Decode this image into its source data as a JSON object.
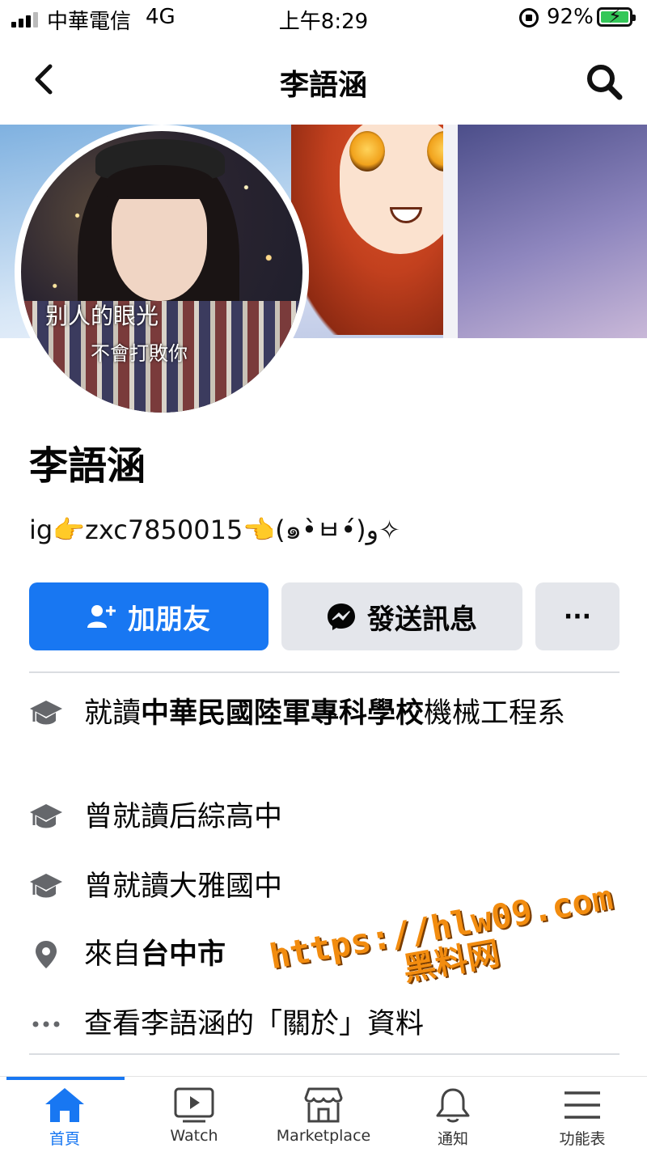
{
  "status_bar": {
    "carrier": "中華電信",
    "network": "4G",
    "time": "上午8:29",
    "battery_percent": "92%",
    "battery_charging": true
  },
  "header": {
    "title": "李語涵",
    "back_icon": "chevron-left-icon",
    "search_icon": "search-icon"
  },
  "profile": {
    "avatar_text_line1": "别人的眼光",
    "avatar_text_line2": "不會打敗你",
    "name": "李語涵",
    "bio": "ig👉zxc7850015👈(๑•̀ㅂ•́)و✧"
  },
  "actions": {
    "add_friend_label": "加朋友",
    "message_label": "發送訊息",
    "more_label": "···"
  },
  "info": {
    "education_1": {
      "prefix": "就讀",
      "school": "中華民國陸軍專科學校",
      "suffix": "機械工程系"
    },
    "education_2": "曾就讀后綜高中",
    "education_3": "曾就讀大雅國中",
    "hometown": {
      "prefix": "來自",
      "city": "台中市"
    },
    "see_about": "查看李語涵的「關於」資料"
  },
  "watermark": {
    "line1": "https://hlw09.com",
    "line2": "黑料网"
  },
  "tabbar": {
    "items": [
      {
        "label": "首頁",
        "icon": "home-icon",
        "active": true
      },
      {
        "label": "Watch",
        "icon": "watch-icon",
        "active": false
      },
      {
        "label": "Marketplace",
        "icon": "marketplace-icon",
        "active": false
      },
      {
        "label": "通知",
        "icon": "bell-icon",
        "active": false
      },
      {
        "label": "功能表",
        "icon": "menu-icon",
        "active": false
      }
    ]
  },
  "colors": {
    "primary": "#1877f2",
    "secondary_button": "#e4e6eb",
    "watermark": "#f28c0f"
  }
}
